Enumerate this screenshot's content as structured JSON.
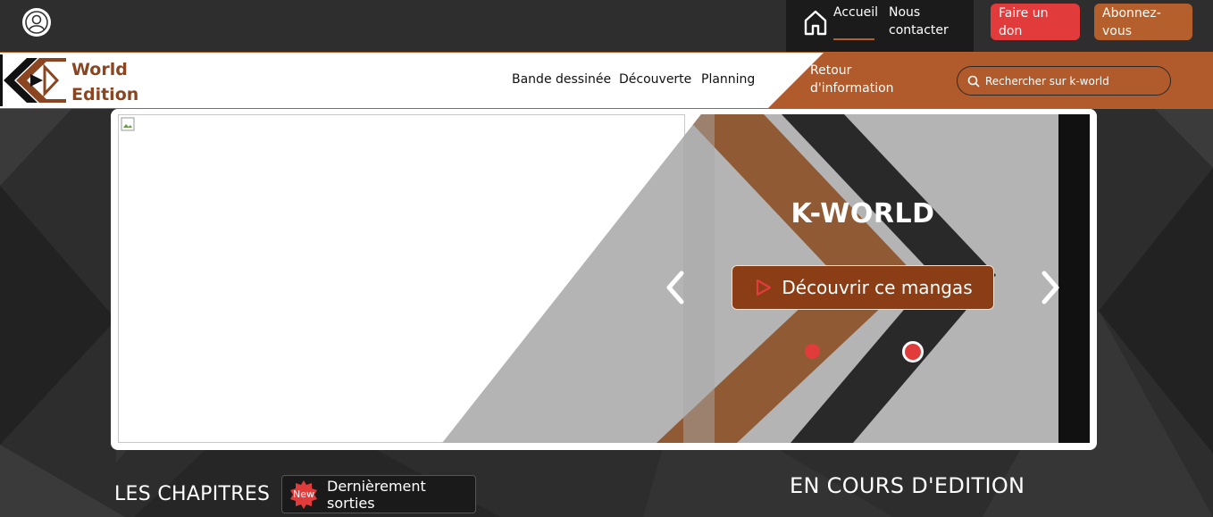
{
  "topbar": {
    "accueil": "Accueil",
    "contact": "Nous contacter",
    "don": "Faire un don",
    "abonnez": "Abonnez-vous"
  },
  "header": {
    "logo_line1": "World",
    "logo_line2": "Edition",
    "nav": [
      "Bande dessinée",
      "Découverte",
      "Planning"
    ],
    "retour": "Retour d'information",
    "search_placeholder": "Rechercher sur k-world"
  },
  "slider": {
    "title": "K-WORLD",
    "cta": "Découvrir ce mangas",
    "active_dot": 2,
    "dot_count": 2
  },
  "sections": {
    "chapitres": "LES CHAPITRES",
    "new_badge": "New",
    "recent": "Dernièrement sorties",
    "en_cours": "EN COURS D'EDITION"
  },
  "colors": {
    "brand_orange": "#b15a2c",
    "accent_red": "#e23b3b",
    "dark_brown": "#8b3d15"
  }
}
